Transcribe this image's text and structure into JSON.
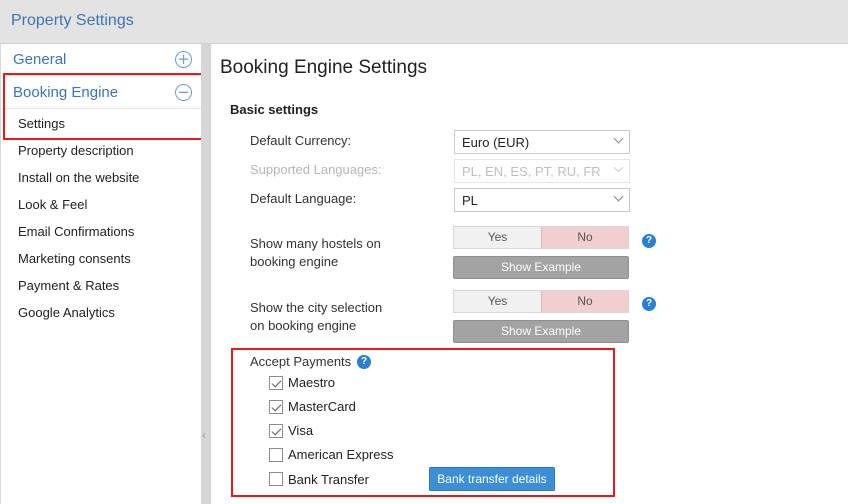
{
  "app": {
    "title": "Property Settings"
  },
  "sidebar": {
    "general": {
      "label": "General",
      "icon": "plus-circle-icon",
      "icon_glyph": "+"
    },
    "booking_engine": {
      "label": "Booking Engine",
      "icon": "minus-circle-icon",
      "icon_glyph": "−"
    },
    "items": [
      {
        "label": "Settings"
      },
      {
        "label": "Property description"
      },
      {
        "label": "Install on the website"
      },
      {
        "label": "Look & Feel"
      },
      {
        "label": "Email Confirmations"
      },
      {
        "label": "Marketing consents"
      },
      {
        "label": "Payment & Rates"
      },
      {
        "label": "Google Analytics"
      }
    ],
    "collapse_glyph": "‹"
  },
  "main": {
    "title": "Booking Engine Settings",
    "section": "Basic settings",
    "default_currency": {
      "label": "Default Currency:",
      "value": "Euro (EUR)"
    },
    "supported_languages": {
      "label": "Supported Languages:",
      "value": "PL, EN, ES, PT, RU, FR"
    },
    "default_language": {
      "label": "Default Language:",
      "value": "PL"
    },
    "many_hostels": {
      "label_line1": "Show many hostels on",
      "label_line2": "booking engine",
      "yes": "Yes",
      "no": "No",
      "selected": "No",
      "button": "Show Example"
    },
    "city_selection": {
      "label_line1": "Show the city selection",
      "label_line2": "on booking engine",
      "yes": "Yes",
      "no": "No",
      "selected": "No",
      "button": "Show Example"
    },
    "help_glyph": "?",
    "accept_payments": {
      "label": "Accept Payments",
      "options": [
        {
          "label": "Maestro",
          "checked": true
        },
        {
          "label": "MasterCard",
          "checked": true
        },
        {
          "label": "Visa",
          "checked": true
        },
        {
          "label": "American Express",
          "checked": false
        },
        {
          "label": "Bank Transfer",
          "checked": false
        }
      ],
      "bank_button": "Bank transfer details"
    }
  },
  "colors": {
    "accent": "#3d75b3",
    "highlight": "#e8191d",
    "primary_button": "#3c8fd6",
    "toggle_no_selected": "#f1cfd0",
    "help_icon": "#2b7fd0"
  }
}
